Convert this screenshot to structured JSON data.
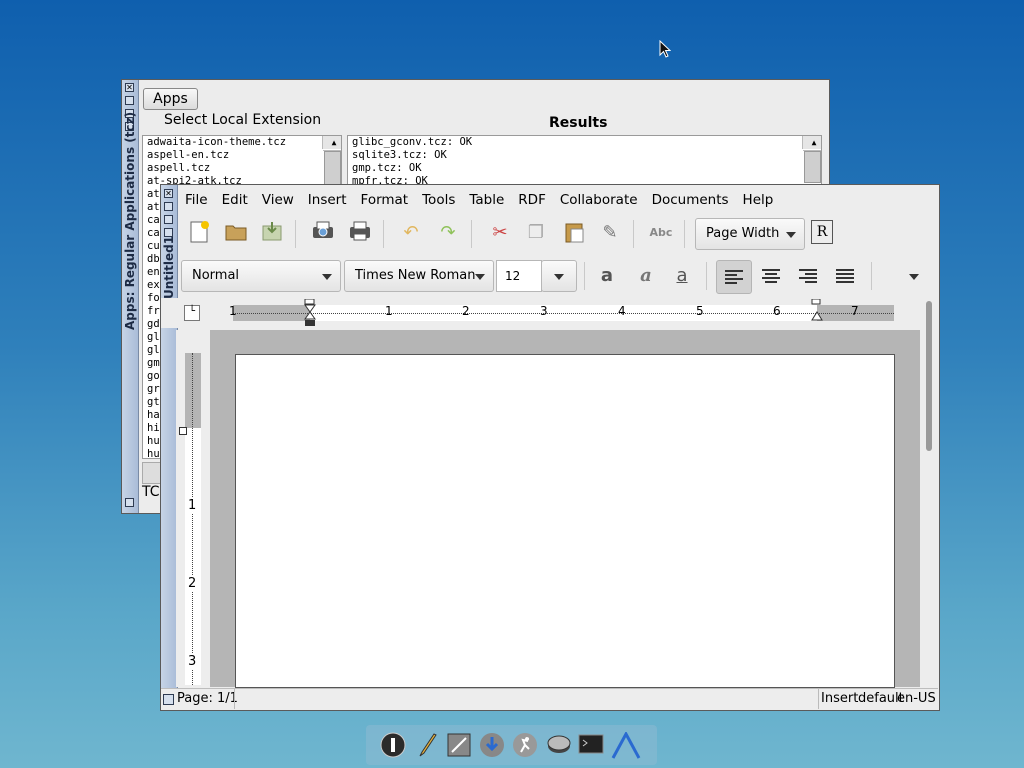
{
  "apps_window": {
    "side_title": "Apps: Regular Applications (tcz)",
    "apps_button": "Apps",
    "select_label": "Select Local Extension",
    "results_label": "Results",
    "local_extensions": [
      "adwaita-icon-theme.tcz",
      "aspell-en.tcz",
      "aspell.tcz",
      "at-spi2-atk.tcz",
      "at",
      "atk",
      "ca",
      "ca",
      "cu",
      "db",
      "en",
      "ex",
      "fo",
      "fr",
      "gd",
      "gl",
      "gl",
      "gm",
      "go",
      "gr",
      "gt",
      "ha",
      "hi",
      "hu",
      "hu"
    ],
    "results": [
      "glibc_gconv.tcz: OK",
      "sqlite3.tcz: OK",
      "gmp.tcz: OK",
      "mpfr.tcz: OK"
    ],
    "bottom_text": "TC"
  },
  "writer": {
    "side_title": "Untitled1",
    "menu": [
      "File",
      "Edit",
      "View",
      "Insert",
      "Format",
      "Tools",
      "Table",
      "RDF",
      "Collaborate",
      "Documents",
      "Help"
    ],
    "zoom": "Page Width",
    "style": "Normal",
    "font": "Times New Roman",
    "size": "12",
    "ruler_numbers": [
      "1",
      "1",
      "2",
      "3",
      "4",
      "5",
      "6",
      "7"
    ],
    "vruler_numbers": [
      "1",
      "2",
      "3"
    ],
    "status": {
      "page": "Page: 1/1",
      "mode": "Insert",
      "lang_style": "default",
      "lang": "en-US"
    }
  },
  "colors": {
    "desktop_top": "#0f5fae",
    "desktop_bottom": "#6fb6cf",
    "title_bar": "#b7c7de"
  }
}
